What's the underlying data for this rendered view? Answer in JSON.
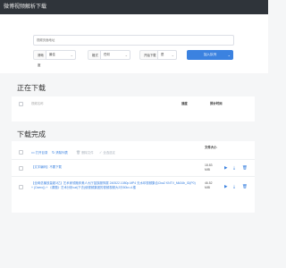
{
  "window": {
    "title": "微博视频解析下载"
  },
  "input": {
    "placeholder": "视频页面地址"
  },
  "controls": {
    "resolution": {
      "label": "清晰度",
      "value": "最佳"
    },
    "format": {
      "label": "格式",
      "value": "任何"
    },
    "start_download": {
      "label": "开始下载",
      "value": "是"
    },
    "add_button": "加入队列"
  },
  "downloading": {
    "title": "正在下载",
    "columns": {
      "name": "视频名称",
      "speed": "速度",
      "eta": "预计时间"
    }
  },
  "completed": {
    "title": "下载完成",
    "toolbar": {
      "open_dir": "打开目录",
      "clear_list": "清除列表",
      "delete_file": "删除文件",
      "select_all": "全选选定"
    },
    "columns": {
      "size": "文件大小"
    },
    "rows": [
      {
        "name": "【文字编码】不要下载",
        "size": "18.83 MiB"
      },
      {
        "name": "【全网总播放量超1亿】艺术家领跑伴美人大厅苗族服饰赛 240522.1080p.MP4 无水印视频集合Cba2 KNTV_Mk34b_ID(P0) + (Ozero)) + 《课题》艺术分析cat(下去)使视频集团的视频视频大2乐50kx.d.楼",
        "size": "46.52 MiB"
      }
    ]
  },
  "icons": {
    "accent": "#3b82e0",
    "titlebar": "#2f343a"
  }
}
